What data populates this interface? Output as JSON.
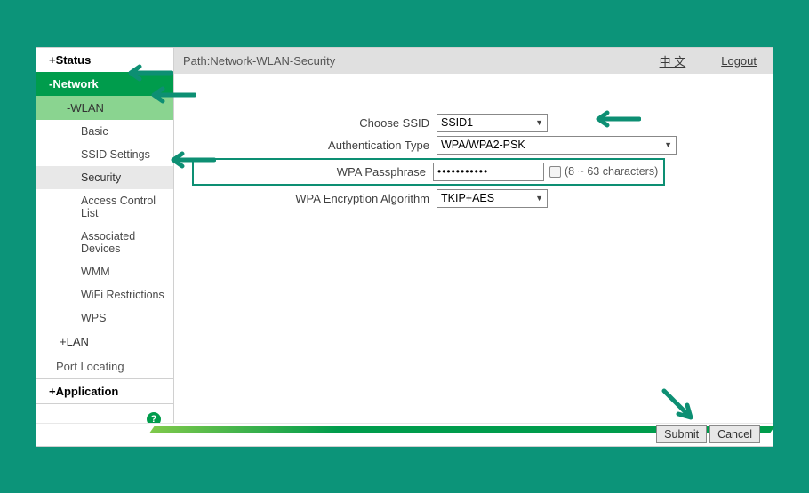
{
  "topbar": {
    "path": "Path:Network-WLAN-Security",
    "lang_link": "中 文",
    "logout": "Logout"
  },
  "sidebar": {
    "status": "+Status",
    "network": "-Network",
    "wlan": "-WLAN",
    "wlan_items": {
      "basic": "Basic",
      "ssid_settings": "SSID Settings",
      "security": "Security",
      "acl": "Access Control List",
      "assoc": "Associated Devices",
      "wmm": "WMM",
      "wifi_restrict": "WiFi Restrictions",
      "wps": "WPS"
    },
    "lan": "+LAN",
    "port_locating": "Port Locating",
    "application": "+Application",
    "help_icon": "?"
  },
  "form": {
    "ssid_label": "Choose SSID",
    "ssid_value": "SSID1",
    "auth_label": "Authentication Type",
    "auth_value": "WPA/WPA2-PSK",
    "pass_label": "WPA Passphrase",
    "pass_value": "•••••••••••",
    "pass_hint": "(8 ~ 63 characters)",
    "enc_label": "WPA Encryption Algorithm",
    "enc_value": "TKIP+AES"
  },
  "buttons": {
    "submit": "Submit",
    "cancel": "Cancel"
  }
}
